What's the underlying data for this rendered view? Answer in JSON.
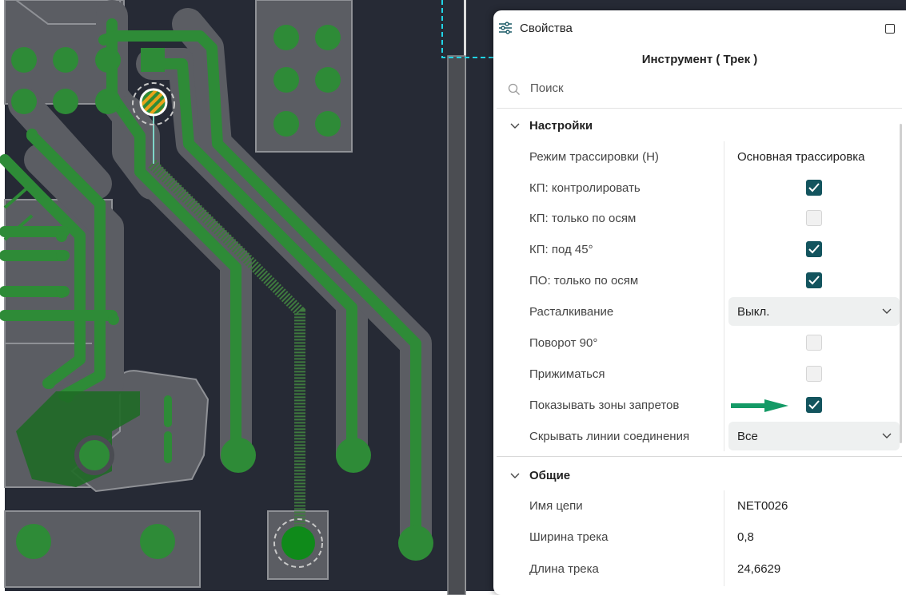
{
  "panel": {
    "title": "Свойства",
    "tool_title": "Инструмент ( Трек )",
    "search_placeholder": "Поиск",
    "sections": {
      "settings": "Настройки",
      "general": "Общие"
    },
    "settings": {
      "routing_mode": {
        "label": "Режим трассировки (H)",
        "value": "Основная трассировка"
      },
      "pad_control": {
        "label": "КП: контролировать",
        "checked": true
      },
      "pad_axes_only": {
        "label": "КП: только по осям",
        "checked": false
      },
      "pad_45": {
        "label": "КП: под 45°",
        "checked": true
      },
      "via_axes_only": {
        "label": "ПО: только по осям",
        "checked": true
      },
      "push": {
        "label": "Расталкивание",
        "value": "Выкл."
      },
      "rotate90": {
        "label": "Поворот 90°",
        "checked": false
      },
      "hug": {
        "label": "Прижиматься",
        "checked": false
      },
      "show_keepouts": {
        "label": "Показывать зоны запретов",
        "checked": true
      },
      "hide_ratsnest": {
        "label": "Скрывать линии соединения",
        "value": "Все"
      }
    },
    "general": {
      "net_name": {
        "label": "Имя цепи",
        "value": "NET0026"
      },
      "track_width": {
        "label": "Ширина трека",
        "value": "0,8"
      },
      "track_length": {
        "label": "Длина трека",
        "value": "24,6629"
      }
    }
  },
  "icons": [
    "sliders-icon",
    "maximize-icon",
    "search-icon",
    "chevron-down-icon",
    "check-icon",
    "arrow-right-icon"
  ],
  "colors": {
    "board": "#262a35",
    "copper_fill": "#5b5d63",
    "trace": "#2e8b37",
    "checkbox_on": "#13545e",
    "arrow": "#149a66",
    "selection": "#21d4e6"
  }
}
